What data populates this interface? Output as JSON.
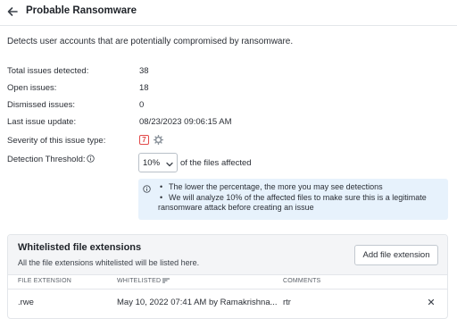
{
  "header": {
    "title": "Probable Ransomware"
  },
  "description": "Detects user accounts that are potentially compromised by ransomware.",
  "stats": {
    "total_label": "Total issues detected:",
    "total_value": "38",
    "open_label": "Open issues:",
    "open_value": "18",
    "dismissed_label": "Dismissed issues:",
    "dismissed_value": "0",
    "last_update_label": "Last issue update:",
    "last_update_value": "08/23/2023 09:06:15 AM",
    "severity_label": "Severity of this issue type:",
    "severity_value": "7",
    "threshold_label": "Detection Threshold:"
  },
  "threshold": {
    "selected": "10%",
    "suffix": "of the files affected"
  },
  "note": {
    "bullet1": "The lower the percentage, the more you may see detections",
    "bullet2_line1": "We will analyze 10% of the affected files to make sure this is a legitimate",
    "bullet2_line2": "ransomware attack before creating an issue"
  },
  "whitelist": {
    "title": "Whitelisted file extensions",
    "subtitle": "All the file extensions whitelisted will be listed here.",
    "add_button": "Add file extension",
    "columns": [
      "FILE EXTENSION",
      "WHITELISTED",
      "COMMENTS"
    ],
    "rows": [
      {
        "extension": ".rwe",
        "whitelisted": "May 10, 2022 07:41 AM by Ramakrishna...",
        "comments": "rtr"
      }
    ]
  },
  "colors": {
    "accent_note_bg": "#e7f2fc",
    "severity_red": "#e24a4a",
    "panel_bg": "#f4f5f7"
  },
  "icons": {
    "back": "arrow-left-icon",
    "gear": "gear-icon",
    "info": "info-circle-icon",
    "chevron": "chevron-down-icon",
    "sort": "sort-icon",
    "close": "close-icon"
  }
}
